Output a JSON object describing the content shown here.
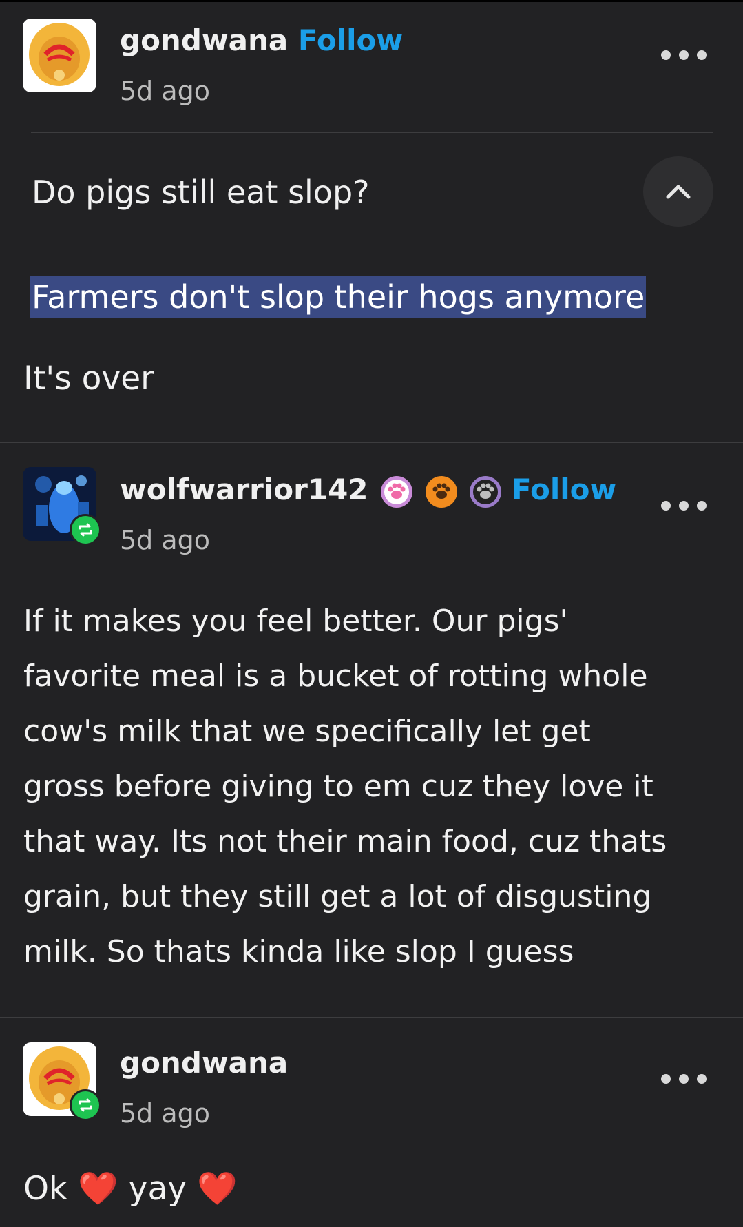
{
  "posts": [
    {
      "username": "gondwana",
      "follow_label": "Follow",
      "time": "5d ago",
      "question": "Do pigs still eat slop?",
      "highlighted_line": "Farmers don't slop their hogs anymore",
      "line2": "It's over"
    },
    {
      "username": "wolfwarrior142",
      "follow_label": "Follow",
      "time": "5d ago",
      "badges": [
        "pink-paw-icon",
        "orange-paw-icon",
        "gray-paw-icon"
      ],
      "body_lines": [
        "If it makes you feel better. Our pigs'",
        "favorite meal is a bucket of rotting whole",
        "cow's milk that we specifically let get",
        "gross before giving to em cuz they love it",
        "that way. Its not their main food, cuz thats",
        "grain, but they still get a lot of disgusting",
        "milk. So thats kinda like slop I guess"
      ]
    },
    {
      "username": "gondwana",
      "time": "5d ago",
      "reply_word1": "Ok",
      "reply_emoji1": "❤️",
      "reply_word2": "yay",
      "reply_emoji2": "❤️"
    }
  ],
  "colors": {
    "background": "#222224",
    "follow": "#1b9ee8",
    "highlight": "#3a4a84",
    "reblog_badge": "#1ec451"
  }
}
